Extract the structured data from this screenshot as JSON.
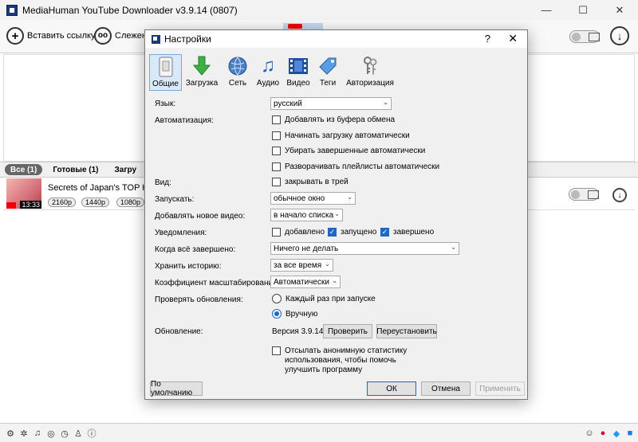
{
  "window": {
    "title": "MediaHuman YouTube Downloader v3.9.14 (0807)",
    "controls": {
      "minimize": "—",
      "maximize": "☐",
      "close": "✕"
    }
  },
  "toolbar": {
    "paste_label": "Вставить ссылку",
    "track_label": "Слежен"
  },
  "filters": {
    "all": "Все (1)",
    "done": "Готовые (1)",
    "downloads": "Загру"
  },
  "video": {
    "title": "Secrets of Japan's TOP Hambu",
    "duration": "13:33",
    "resolutions": [
      "2160p",
      "1440p",
      "1080p"
    ]
  },
  "dialog": {
    "title": "Настройки",
    "help": "?",
    "close": "✕",
    "tabs": [
      "Общие",
      "Загрузка",
      "Сеть",
      "Аудио",
      "Видео",
      "Теги",
      "Авторизация"
    ],
    "language": {
      "label": "Язык:",
      "value": "русский"
    },
    "automation": {
      "label": "Автоматизация:",
      "options": [
        {
          "text": "Добавлять из буфера обмена",
          "checked": false
        },
        {
          "text": "Начинать загрузку автоматически",
          "checked": false
        },
        {
          "text": "Убирать завершенные автоматически",
          "checked": false
        },
        {
          "text": "Разворачивать плейлисты автоматически",
          "checked": false
        }
      ]
    },
    "view": {
      "label": "Вид:",
      "option": "закрывать в трей",
      "checked": false
    },
    "launch": {
      "label": "Запускать:",
      "value": "обычное окно"
    },
    "add_new": {
      "label": "Добавлять новое видео:",
      "value": "в начало списка"
    },
    "notifications": {
      "label": "Уведомления:",
      "added": "добавлено",
      "added_checked": false,
      "started": "запущено",
      "started_checked": true,
      "finished": "завершено",
      "finished_checked": true
    },
    "when_done": {
      "label": "Когда всё завершено:",
      "value": "Ничего не делать"
    },
    "history": {
      "label": "Хранить историю:",
      "value": "за все время"
    },
    "scale": {
      "label": "Коэффициент масштабирования:",
      "value": "Автоматически"
    },
    "updates": {
      "label": "Проверять обновления:",
      "on_start": "Каждый раз при запуске",
      "manual": "Вручную",
      "selected": "manual"
    },
    "update": {
      "label": "Обновление:",
      "version": "Версия 3.9.14",
      "check": "Проверить",
      "reinstall": "Переустановить"
    },
    "stats": {
      "line1": "Отсылать анонимную статистику",
      "line2": "использования, чтобы помочь",
      "line3": "улучшить программу",
      "checked": false
    },
    "buttons": {
      "defaults": "По умолчанию",
      "ok": "ОК",
      "cancel": "Отмена",
      "apply": "Применить"
    }
  }
}
